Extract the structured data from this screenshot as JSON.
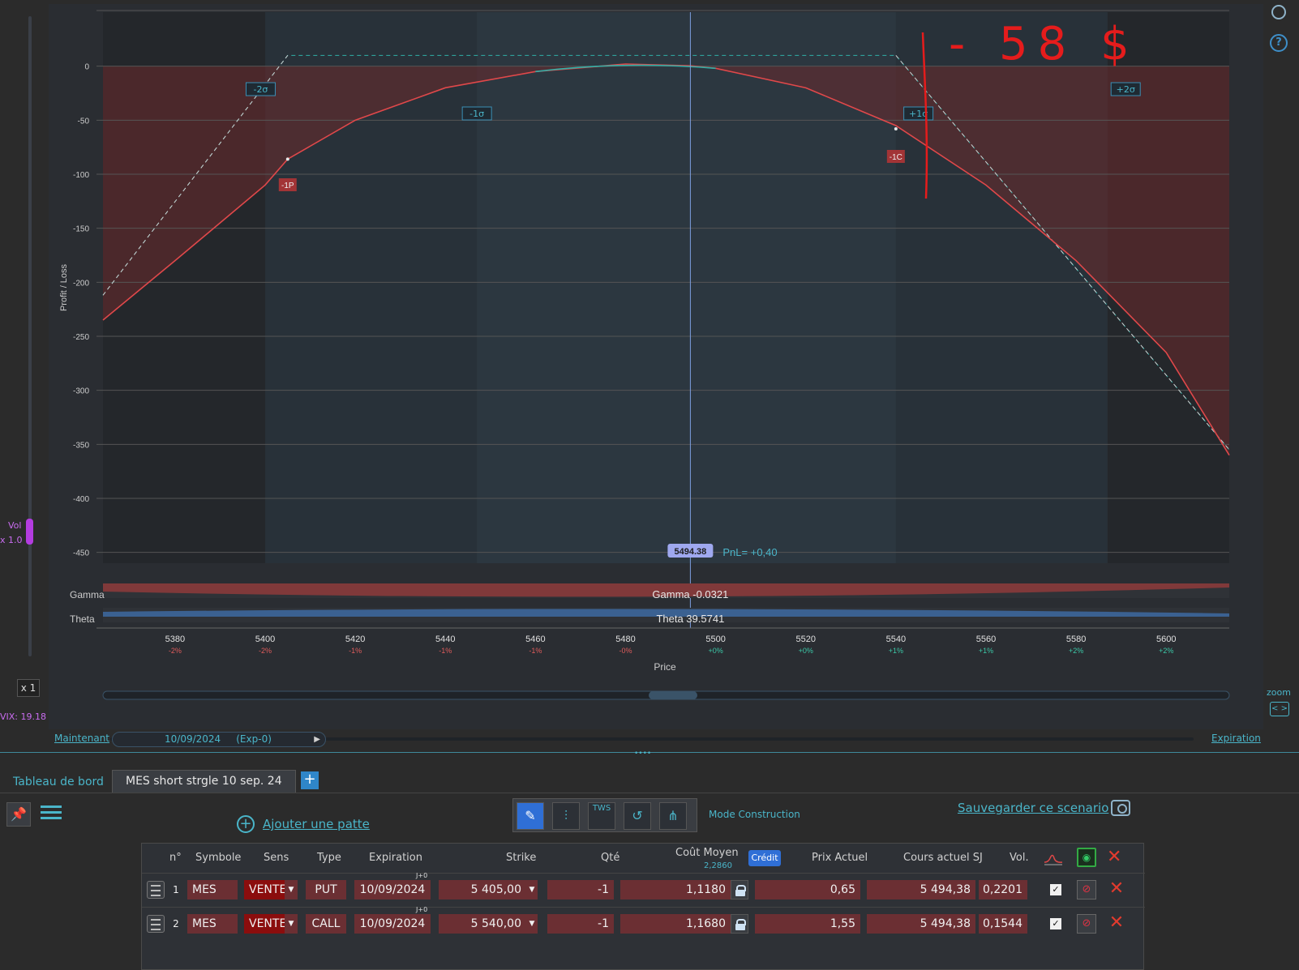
{
  "left_rail": {
    "vol_label": "Vol",
    "vol_multiplier": "x 1.0",
    "x1_button": "x 1",
    "vix_label": "VIX: 19.18"
  },
  "chart": {
    "y_axis_label": "Profit / Loss",
    "x_axis_label": "Price",
    "y_ticks": [
      "0",
      "-50",
      "-100",
      "-150",
      "-200",
      "-250",
      "-300",
      "-350",
      "-400",
      "-450"
    ],
    "x_ticks": [
      {
        "price": "5380",
        "pct": "-2%"
      },
      {
        "price": "5400",
        "pct": "-2%"
      },
      {
        "price": "5420",
        "pct": "-1%"
      },
      {
        "price": "5440",
        "pct": "-1%"
      },
      {
        "price": "5460",
        "pct": "-1%"
      },
      {
        "price": "5480",
        "pct": "-0%"
      },
      {
        "price": "5500",
        "pct": "+0%"
      },
      {
        "price": "5520",
        "pct": "+0%"
      },
      {
        "price": "5540",
        "pct": "+1%"
      },
      {
        "price": "5560",
        "pct": "+1%"
      },
      {
        "price": "5580",
        "pct": "+2%"
      },
      {
        "price": "5600",
        "pct": "+2%"
      }
    ],
    "sigma_labels": [
      "-2σ",
      "-1σ",
      "+1σ",
      "+2σ"
    ],
    "leg_markers": [
      "-1P",
      "-1C"
    ],
    "current_price": "5494.38",
    "pnl_label": "PnL= +0,40",
    "gamma_label": "Gamma",
    "gamma_value": "Gamma -0.0321",
    "theta_label": "Theta",
    "theta_value": "Theta 39.5741",
    "annotation": "- 58 $",
    "colors": {
      "pnl_curve": "#e0484a",
      "expiry_line": "#2fb0a8",
      "price_line": "#7d9fe0",
      "loss_fill": "#6b2a2c"
    }
  },
  "chart_data": {
    "type": "line",
    "xlabel": "Price",
    "ylabel": "Profit / Loss",
    "xlim": [
      5364,
      5614
    ],
    "ylim": [
      -460,
      50
    ],
    "series": [
      {
        "values": [
          [
            5364,
            -235
          ],
          [
            5380,
            -180
          ],
          [
            5400,
            -110
          ],
          [
            5405,
            -86
          ],
          [
            5420,
            -50
          ],
          [
            5440,
            -20
          ],
          [
            5460,
            -5
          ],
          [
            5480,
            2
          ],
          [
            5494.38,
            0.4
          ],
          [
            5500,
            -2
          ],
          [
            5520,
            -20
          ],
          [
            5540,
            -55
          ],
          [
            5560,
            -110
          ],
          [
            5580,
            -180
          ],
          [
            5600,
            -265
          ],
          [
            5614,
            -360
          ]
        ]
      },
      {
        "values": [
          [
            5364,
            -212
          ],
          [
            5405,
            10
          ],
          [
            5540,
            10
          ],
          [
            5614,
            -355
          ]
        ]
      }
    ],
    "current_price": 5494.38
  },
  "time_bar": {
    "now_label": "Maintenant",
    "date_label": "10/09/2024",
    "exp_label": "(Exp-0)",
    "expiration_label": "Expiration"
  },
  "right_rail": {
    "help": "?",
    "zoom": "zoom",
    "zoom_btn": "< >"
  },
  "tabs": {
    "dashboard": "Tableau de bord",
    "scenario": "MES short strgle 10 sep. 24",
    "add": "+"
  },
  "toolbar": {
    "add_leg": "Ajouter une patte",
    "mode": "Mode Construction",
    "save": "Sauvegarder ce scenario",
    "tws": "TWS"
  },
  "table": {
    "headers": {
      "no": "n°",
      "symbol": "Symbole",
      "sense": "Sens",
      "type": "Type",
      "expiration": "Expiration",
      "strike": "Strike",
      "qty": "Qté",
      "avg_cost": "Coût Moyen",
      "avg_cost_sub": "2,2860",
      "credit": "Crédit",
      "current_price": "Prix Actuel",
      "underlying": "Cours actuel SJ",
      "vol": "Vol."
    },
    "rows": [
      {
        "no": "1",
        "symbol": "MES",
        "sense": "VENTE",
        "type": "PUT",
        "expiration": "10/09/2024",
        "j": "J+0",
        "strike": "5 405,00",
        "qty": "-1",
        "avg_cost": "1,1180",
        "current_price": "0,65",
        "underlying": "5 494,38",
        "vol": "0,2201"
      },
      {
        "no": "2",
        "symbol": "MES",
        "sense": "VENTE",
        "type": "CALL",
        "expiration": "10/09/2024",
        "j": "J+0",
        "strike": "5 540,00",
        "qty": "-1",
        "avg_cost": "1,1680",
        "current_price": "1,55",
        "underlying": "5 494,38",
        "vol": "0,1544"
      }
    ]
  }
}
